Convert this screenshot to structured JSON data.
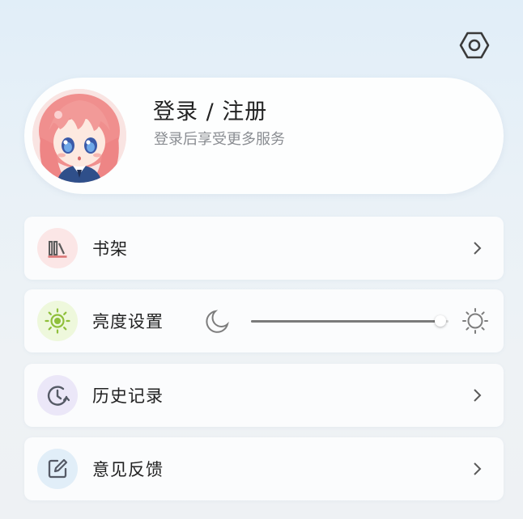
{
  "header": {
    "settings_icon": "hexagon-settings-icon"
  },
  "profile": {
    "title": "登录 / 注册",
    "subtitle": "登录后享受更多服务",
    "avatar_icon": "anime-avatar"
  },
  "menu": {
    "bookshelf": {
      "label": "书架",
      "icon": "bookshelf-icon",
      "icon_bg": "#fbe6e6",
      "icon_color": "#5b5b5b"
    },
    "brightness": {
      "label": "亮度设置",
      "icon": "sun-icon",
      "icon_bg": "#eef8dc",
      "icon_color": "#8fbf3a",
      "level": 0.96
    },
    "history": {
      "label": "历史记录",
      "icon": "history-clock-icon",
      "icon_bg": "#ebe7f8",
      "icon_color": "#555a66"
    },
    "feedback": {
      "label": "意见反馈",
      "icon": "edit-icon",
      "icon_bg": "#e1eef8",
      "icon_color": "#555a66"
    }
  },
  "colors": {
    "background": "#e4eff7",
    "card": "#fbfcfd",
    "subtitle_text": "#8a8d92"
  }
}
